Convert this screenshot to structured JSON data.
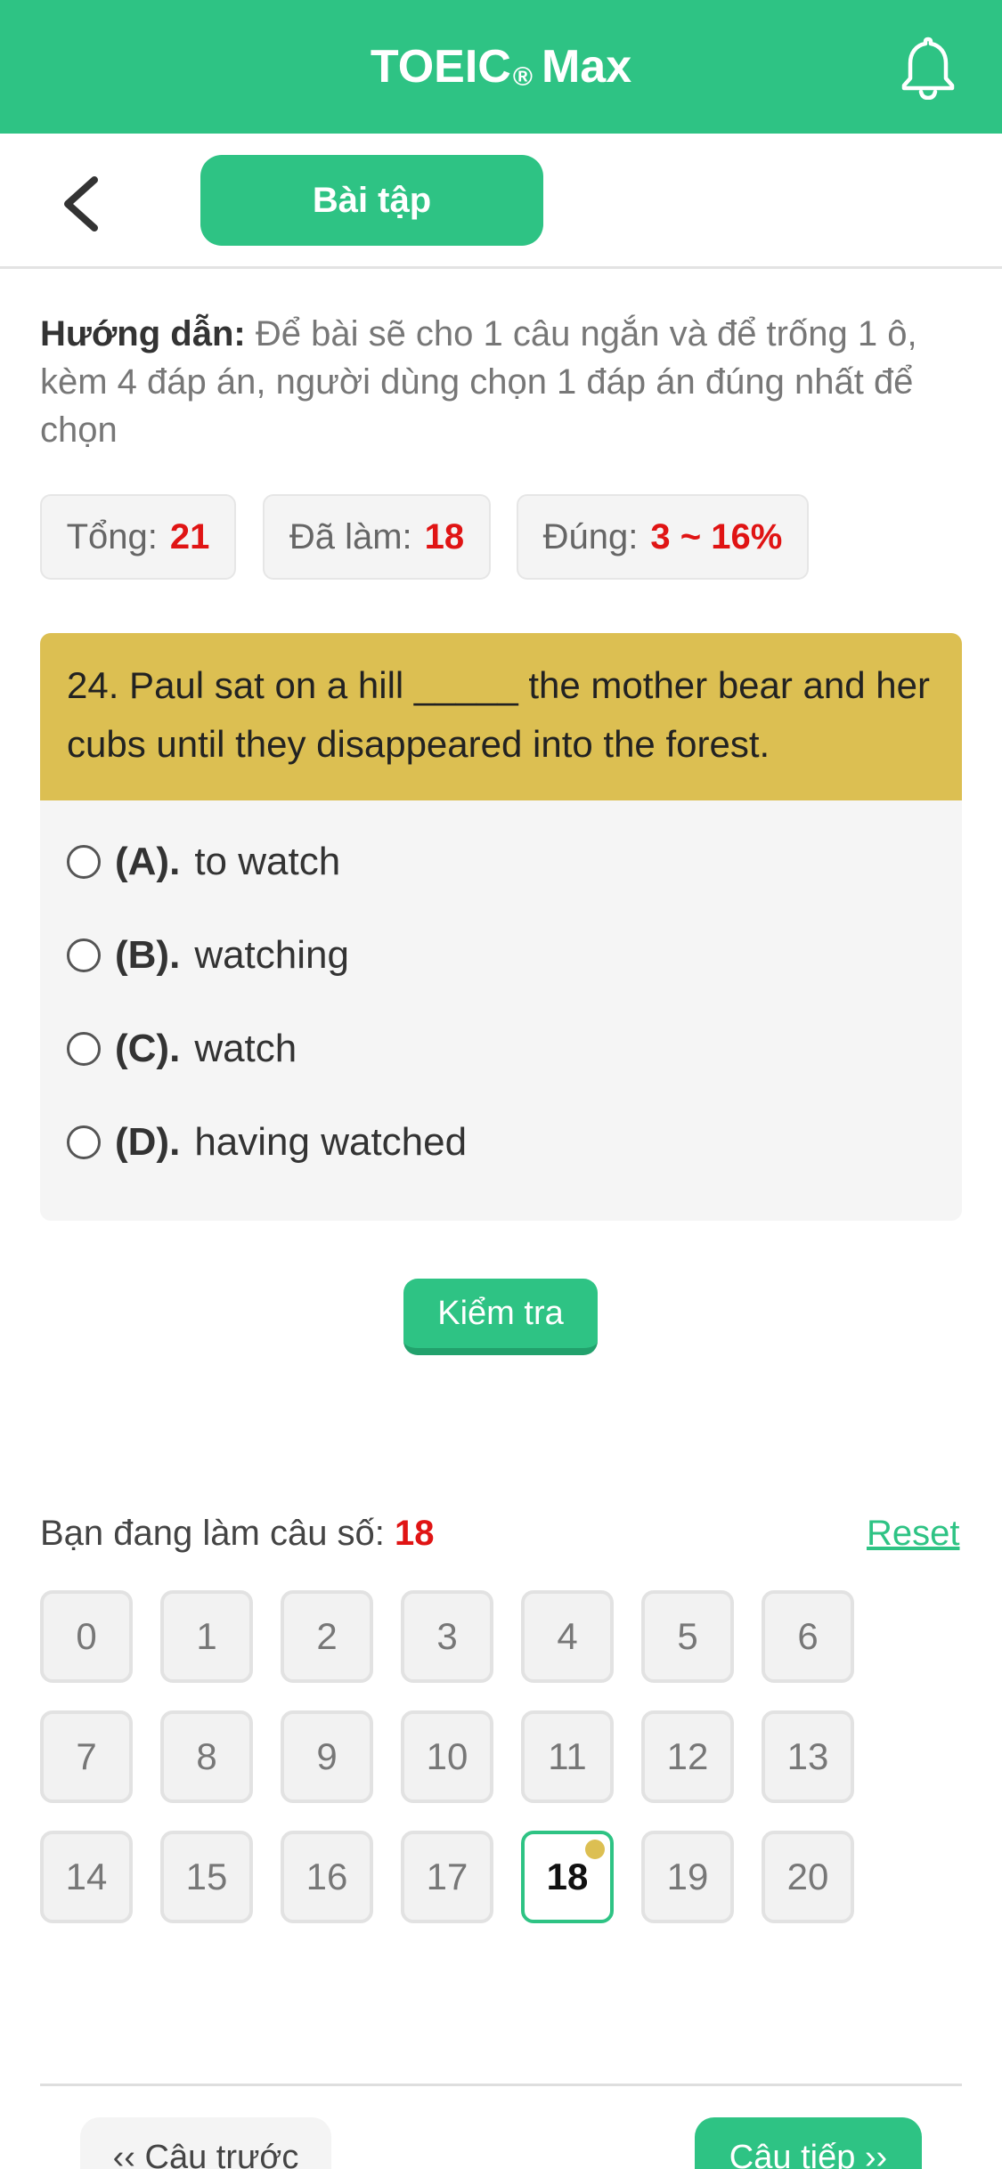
{
  "header": {
    "title": "TOEIC",
    "trademark": "®",
    "title_suffix": "Max",
    "bell_icon": "bell-icon"
  },
  "subheader": {
    "back_icon": "chevron-left-icon",
    "tab_label": "Bài tập"
  },
  "instructions": {
    "label": "Hướng dẫn:",
    "text": "Để bài sẽ cho 1 câu ngắn và để trống 1 ô, kèm 4 đáp án, người dùng chọn 1 đáp án đúng nhất để chọn"
  },
  "stats": {
    "total_label": "Tổng:",
    "total_value": "21",
    "done_label": "Đã làm:",
    "done_value": "18",
    "correct_label": "Đúng:",
    "correct_value": "3 ~ 16%"
  },
  "question": {
    "text": "24. Paul sat on a hill _____ the mother bear and her cubs until they disappeared into the forest.",
    "options": [
      {
        "letter": "(A).",
        "text": "to watch"
      },
      {
        "letter": "(B).",
        "text": "watching"
      },
      {
        "letter": "(C).",
        "text": "watch"
      },
      {
        "letter": "(D).",
        "text": "having watched"
      }
    ]
  },
  "check_button": "Kiểm tra",
  "progress": {
    "current_label": "Bạn đang làm câu số:",
    "current_value": "18",
    "reset_label": "Reset",
    "numbers": [
      "0",
      "1",
      "2",
      "3",
      "4",
      "5",
      "6",
      "7",
      "8",
      "9",
      "10",
      "11",
      "12",
      "13",
      "14",
      "15",
      "16",
      "17",
      "18",
      "19",
      "20"
    ],
    "active_index": 18
  },
  "navigation": {
    "prev_label": "‹‹ Câu trước",
    "next_label": "Câu tiếp ››"
  },
  "colors": {
    "primary": "#2ec384",
    "question_header": "#dcbf52",
    "accent_red": "#e01414"
  }
}
